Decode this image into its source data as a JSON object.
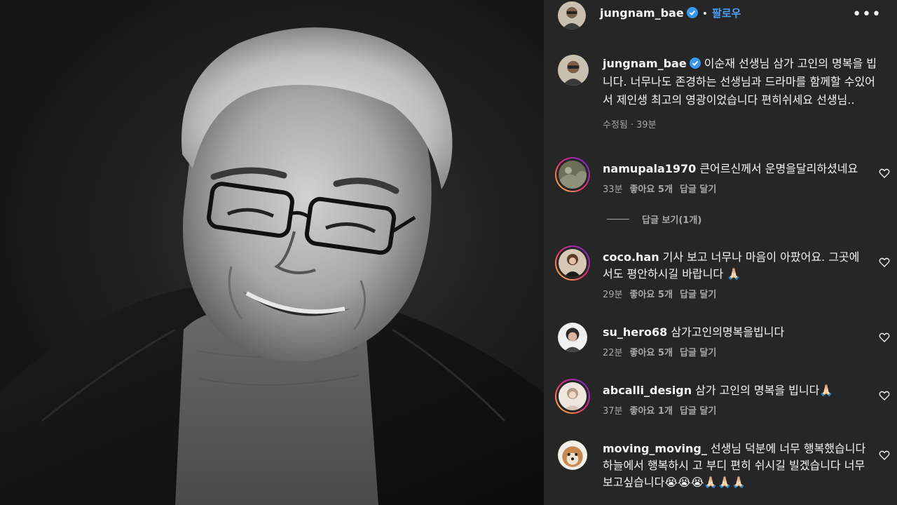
{
  "post": {
    "username": "jungnam_bae",
    "follow_label": "팔로우",
    "caption_username": "jungnam_bae",
    "caption_text": "이순재 선생님 삼가 고인의 명복을 빕니다. 너무나도 존경하는 선생님과 드라마를 함께할 수있어서 제인생 최고의 영광이었습니다 편히쉬세요 선생님..",
    "caption_edited": "수정됨",
    "caption_time": "39분"
  },
  "labels": {
    "likes_prefix": "좋아요",
    "reply": "답글 달기",
    "view_replies": "답글 보기(1개)"
  },
  "comments": [
    {
      "username": "namupala1970",
      "text": "큰어르신께서 운명을달리하셨네요",
      "time": "33분",
      "likes": "좋아요 5개",
      "reply": "답글 달기"
    },
    {
      "username": "coco.han",
      "text": "기사 보고 너무나 마음이 아팠어요. 그곳에서도 평안하시길 바랍니다 🙏🏻",
      "time": "29분",
      "likes": "좋아요 5개",
      "reply": "답글 달기"
    },
    {
      "username": "su_hero68",
      "text": "삼가고인의명복을빕니다",
      "time": "22분",
      "likes": "좋아요 5개",
      "reply": "답글 달기"
    },
    {
      "username": "abcalli_design",
      "text": "삼가 고인의 명복을 빕니다🙏🏻",
      "time": "37분",
      "likes": "좋아요 1개",
      "reply": "답글 달기"
    },
    {
      "username": "moving_moving_",
      "text": "선생님 덕분에 너무 행복했습니다 하늘에서 행복하시 고 부디 편히 쉬시길 빌겠습니다 너무 보고싶습니다😭😭😭🙏🏻🙏🏻🙏🏻",
      "time": "",
      "likes": "",
      "reply": ""
    }
  ],
  "colors": {
    "panel_bg": "#262626",
    "link_blue": "#4a9ff5",
    "muted_text": "#a8a8a8",
    "verified_blue": "#3897f0"
  },
  "icons": [
    "verified-badge-icon",
    "more-options-icon",
    "heart-icon"
  ]
}
